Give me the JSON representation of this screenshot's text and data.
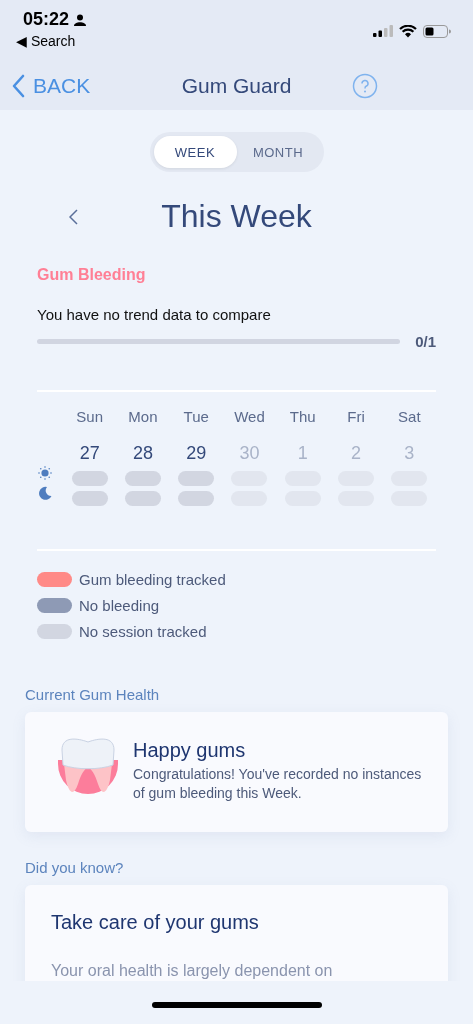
{
  "status_bar": {
    "time": "05:22",
    "back_app": "◀ Search"
  },
  "nav": {
    "back": "BACK",
    "title": "Gum Guard"
  },
  "period_tabs": [
    {
      "label": "WEEK",
      "selected": true
    },
    {
      "label": "MONTH",
      "selected": false
    }
  ],
  "period_title": "This Week",
  "gum_bleeding": {
    "title": "Gum Bleeding",
    "trend_text": "You have no trend data to compare",
    "level": 0,
    "reading": "0/1",
    "days": [
      {
        "weekday": "Sun",
        "date": "27",
        "future": false,
        "morning_tracked": false,
        "evening_tracked": false
      },
      {
        "weekday": "Mon",
        "date": "28",
        "future": false,
        "morning_tracked": false,
        "evening_tracked": false
      },
      {
        "weekday": "Tue",
        "date": "29",
        "future": false,
        "morning_tracked": false,
        "evening_tracked": false
      },
      {
        "weekday": "Wed",
        "date": "30",
        "future": true,
        "morning_tracked": false,
        "evening_tracked": false
      },
      {
        "weekday": "Thu",
        "date": "1",
        "future": true,
        "morning_tracked": false,
        "evening_tracked": false
      },
      {
        "weekday": "Fri",
        "date": "2",
        "future": true,
        "morning_tracked": false,
        "evening_tracked": false
      },
      {
        "weekday": "Sat",
        "date": "3",
        "future": true,
        "morning_tracked": false,
        "evening_tracked": false
      }
    ]
  },
  "legend": [
    {
      "label": "Gum bleeding tracked",
      "color": "#ff8a87"
    },
    {
      "label": "No bleeding",
      "color": "#8e9ab5"
    },
    {
      "label": "No session tracked",
      "color": "#d2d6e1"
    }
  ],
  "current_health": {
    "heading": "Current Gum Health",
    "title": "Happy gums",
    "message": "Congratulations! You've recorded no instances of gum bleeding this Week."
  },
  "did_you_know": {
    "heading": "Did you know?",
    "title": "Take care of your gums",
    "text": "Your oral health is largely dependent on"
  }
}
